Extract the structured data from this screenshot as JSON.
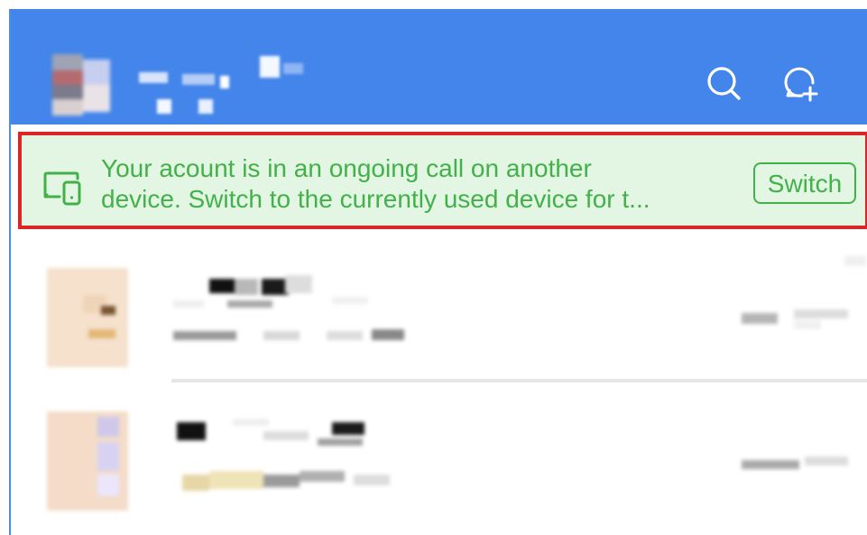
{
  "header": {
    "search_icon": "search-icon",
    "new_chat_icon": "chat-add-icon",
    "background": "#4385ea"
  },
  "banner": {
    "icon": "multi-device-icon",
    "message_line1": "Your acount is in an ongoing call on another",
    "message_line2": "device. Switch to the currently used device for t...",
    "switch_label": "Switch",
    "text_color": "#43b14a",
    "background": "#e3f5e3",
    "highlight_color": "#dc2626"
  }
}
